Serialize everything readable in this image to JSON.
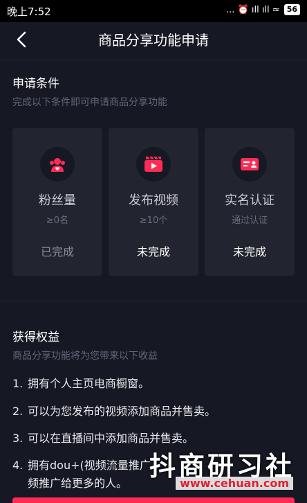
{
  "status_bar": {
    "time": "晚上7:52",
    "indicators": "... ⏰ ıll ıll ≈",
    "battery": "56"
  },
  "nav": {
    "title": "商品分享功能申请"
  },
  "conditions": {
    "title": "申请条件",
    "subtitle": "完成以下条件即可申请商品分享功能",
    "cards": [
      {
        "title": "粉丝量",
        "requirement": "≥0名",
        "status": "已完成",
        "icon": "fans-icon"
      },
      {
        "title": "发布视频",
        "requirement": "≥10个",
        "status": "未完成",
        "icon": "video-clapper-icon"
      },
      {
        "title": "实名认证",
        "requirement": "通过认证",
        "status": "未完成",
        "icon": "id-card-icon"
      }
    ]
  },
  "benefits": {
    "title": "获得权益",
    "subtitle": "商品分享功能将为您带来以下收益",
    "items": [
      {
        "num": "1.",
        "text": "拥有个人主页电商橱窗。"
      },
      {
        "num": "2.",
        "text": "可以为您发布的视频添加商品并售卖。"
      },
      {
        "num": "3.",
        "text": "可以在直播间中添加商品并售卖。"
      },
      {
        "num": "4.",
        "text": "拥有dou+(视频流量推广"
      },
      {
        "num": "",
        "text": "频推广给更多的人。"
      }
    ]
  },
  "watermark": {
    "text": "抖商研习社",
    "url": "www.cehuan.com"
  },
  "colors": {
    "background": "#161823",
    "card": "#22242f",
    "accent": "#fe2c55"
  }
}
